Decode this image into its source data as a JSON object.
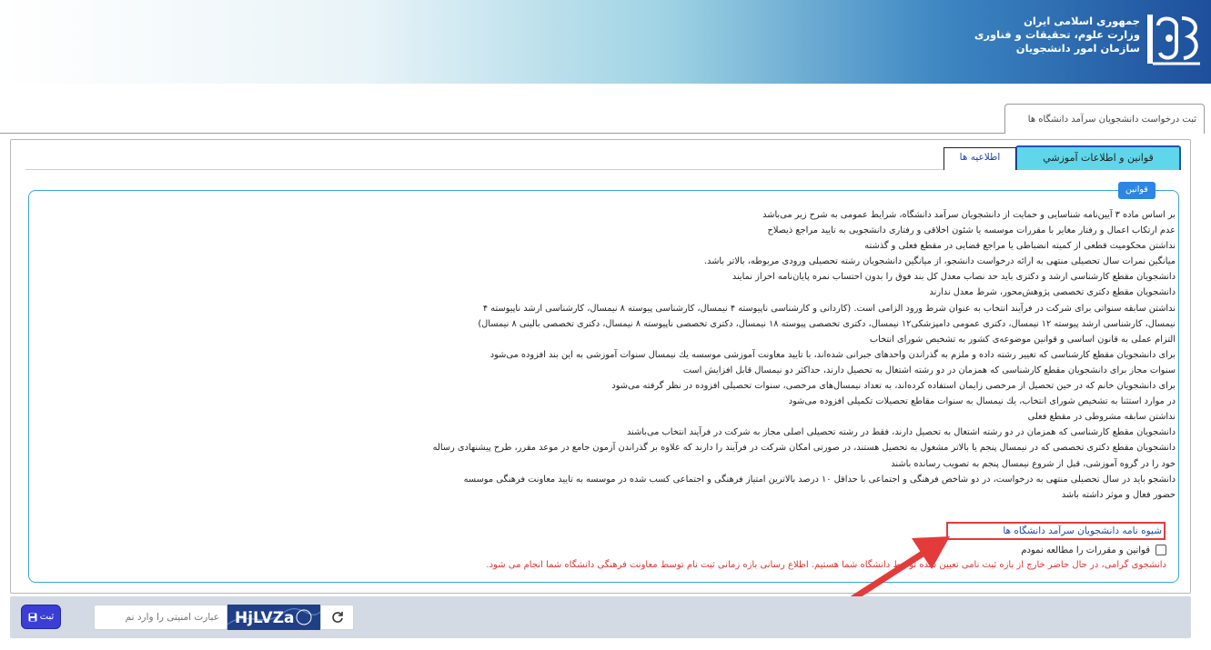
{
  "header": {
    "org_lines": [
      "جمهوری اسلامی ایران",
      "وزارت علوم، تحقیقات و فناوری",
      "سازمان امور دانشجویان"
    ],
    "brand_color": "#1d4f9c"
  },
  "breadcrumb": {
    "tab_label": "ثبت درخواست دانشجويان سرآمد دانشگاه ها"
  },
  "tabs": [
    {
      "label": "قوانين و اطلاعات آموزشي",
      "active": true
    },
    {
      "label": "اطلاعیه ها",
      "active": false
    }
  ],
  "rules_section": {
    "legend": "قوانین",
    "lines": [
      "بر اساس ماده ۳ آیین‌نامه شناسایی و حمایت از دانشجویان سرآمد دانشگاه، شرایط عمومی به شرح زیر می‌باشد",
      "عدم ارتكاب اعمال و رفتار مغاير با مقررات موسسه يا شئون اخلاقی و رفتاری دانشجویی به تاييد مراجع ذيصلاح",
      "نداشتن محكوميت قطعی از كميته انضباطی يا مراجع قضايی در مقطع فعلی و گذشته",
      "ميانگين نمرات سال تحصيلی منتهی به ارائه درخواست دانشجو، از ميانگين دانشجويان رشته تحصيلی ورودی مربوطه، بالاتر باشد.",
      "دانشجویان مقطع كارشناسی ارشد و دکتری بايد حد نصاب معدل كل بند فوق را بدون احتساب نمره پايان‌نامه احراز نمايند",
      "دانشجويان مقطع دکتری تخصصی پژوهش‌محور، شرط معدل ندارند",
      "نداشتن سابقه سنواتی برای شرکت در فرآيند انتخاب به عنوان شرط ورود الزامی است. (كاردانی و كارشناسی ناپيوسته ۴ نیمسال، کارشناسی پیوسته ۸ نیمسال، کارشناسی ارشد ناپيوسته ۴",
      "نیمسال، كارشناسی ارشد پيوسته ۱۲ نیمسال، دکتری عمومی دامپزشکی۱۲ نیمسال، دکتری تخصصی پیوسته ۱۸ نیمسال، دکتری تخصصی ناپيوسته ۸ نیمسال، دکتری تخصصی بالینی ۸ نیمسال)",
      "التزام عملی به قانون اساسی و قوانين موضوعه‌ی کشور به تشخيص شورای انتخاب",
      "برای دانشجويان مقطع كارشناسی كه تغيير رشته داده و ملزم به گذراندن واحدهای جبرانی شده‌اند، با تاييد معاونت آموزشی موسسه يك نيمسال سنوات آموزشی به اين بند افزوده می‌شود",
      "سنوات مجاز برای دانشجويان مقطع كارشناسی كه همزمان در دو رشته اشتغال به تحصيل دارند، حداكثر دو نيمسال قابل افزايش است",
      "برای دانشجويان خانم كه در حين تحصيل از مرخصی زايمان استفاده كرده‌اند، به تعداد نيمسال‌های مرخصی، سنوات تحصيلی افزوده در نظر گرفته می‌شود",
      "در موارد استثنا به تشخيص شورای انتخاب، يك نيمسال به سنوات مقاطع تحصيلات تكميلی افزوده می‌شود",
      "نداشتن سابقه مشروطی در مقطع فعلی",
      "دانشجويان مقطع كارشناسی كه همزمان در دو رشته اشتغال به تحصيل دارند، فقط در رشته تحصيلی اصلی مجاز به شركت در فرآيند انتخاب می‌باشند",
      "دانشجويان مقطع دكتری تخصصی كه در نيمسال پنجم يا بالاتر مشغول به تحصيل هستند، در صورتی امكان شركت در فرآيند را دارند كه علاوه بر گذراندن آزمون جامع در موعد مقرر، طرح پيشنهادی رساله",
      "خود را در گروه آموزشی، قبل از شروع نيمسال پنجم به تصويب رسانده باشند",
      "دانشجو بايد در سال تحصيلی منتهی به درخواست، در دو شاخص فرهنگی و اجتماعی با حداقل ۱۰ درصد بالاترين امتياز فرهنگی و اجتماعی كسب شده در موسسه به تاييد معاونت فرهنگی موسسه",
      "حضور فعال و موثر داشته باشد"
    ],
    "guide_link": "شیوه نامه دانشجویان سرآمد دانشگاه ها",
    "agree_label": "قوانين و مقررات را مطالعه نمودم",
    "agree_checked": false,
    "notice": "دانشجوی گرامی، در حال حاضر خارج از بازه ثبت نامی تعیین شده توسط دانشگاه شما هستیم. اطلاع رسانی بازه زمانی ثبت نام توسط معاونت فرهنگی دانشگاه شما انجام می شود."
  },
  "footer": {
    "submit_label": "ثبت",
    "security_placeholder": "عبارت امنیتی را وارد نم",
    "captcha_text": "HjLVZa"
  }
}
